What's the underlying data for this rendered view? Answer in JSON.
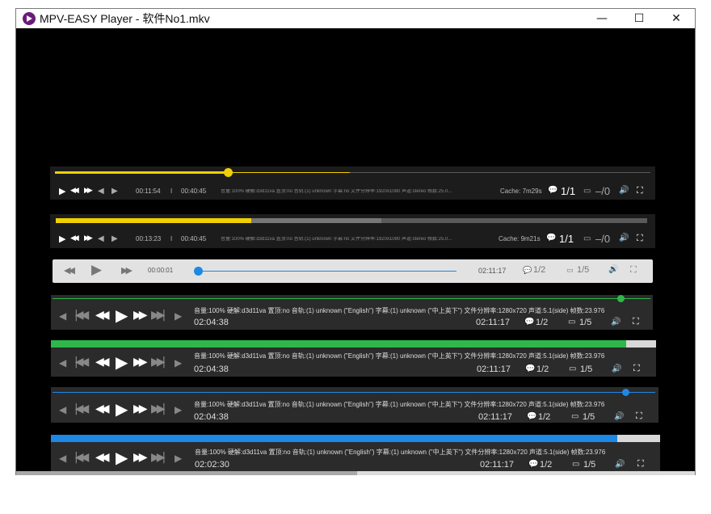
{
  "window": {
    "title": "MPV-EASY Player - 软件No1.mkv",
    "min": "—",
    "max": "☐",
    "close": "✕"
  },
  "icons": {
    "play": "▶",
    "rewind": "◀◀",
    "forward": "▶▶",
    "prev": "◀",
    "next": "▶",
    "skip_back": "|◀◀",
    "skip_fwd": "▶▶|",
    "comment": "💬",
    "sub": "▭",
    "volume": "🔊",
    "screen": "⛶"
  },
  "bar1": {
    "time": "00:11:54",
    "sep": "I",
    "duration": "00:40:45",
    "info": "音量:100% 硬解:d3d11va 置顶:no 音轨:(1) unknown 字幕:no 文件分辨率:1920x1080 声道:stereo 帧数:25.0...",
    "cache": "Cache: 7m29s",
    "chapters": "1/1",
    "subs": "–/0",
    "progress": 0.29,
    "buffer": 0.495,
    "color": "#f0d000"
  },
  "bar2": {
    "time": "00:13:23",
    "sep": "I",
    "duration": "00:40:45",
    "info": "音量:100% 硬解:d3d11va 置顶:no 音轨:(1) unknown 字幕:no 文件分辨率:1920x1080 声道:stereo 帧数:25.0...",
    "cache": "Cache: 9m21s",
    "chapters": "1/1",
    "subs": "–/0",
    "progress": 0.33,
    "buffer": 0.55,
    "color": "#f0d000"
  },
  "bar3": {
    "time": "00:00:01",
    "duration": "02:11:17",
    "chapters": "1/2",
    "subs": "1/5",
    "progress": 0.0,
    "color": "#1e88e5"
  },
  "bar4": {
    "info": "音量:100% 硬解:d3d11va 置顶:no 音轨:(1) unknown (\"English\") 字幕:(1) unknown (\"中上英下\") 文件分辨率:1280x720 声道:5.1(side) 帧数:23.976",
    "time": "02:04:38",
    "duration": "02:11:17",
    "chapters": "1/2",
    "subs": "1/5",
    "progress": 0.95,
    "color": "#2eb84a"
  },
  "bar5": {
    "info": "音量:100% 硬解:d3d11va 置顶:no 音轨:(1) unknown (\"English\") 字幕:(1) unknown (\"中上英下\") 文件分辨率:1280x720 声道:5.1(side) 帧数:23.976",
    "time": "02:04:38",
    "duration": "02:11:17",
    "chapters": "1/2",
    "subs": "1/5",
    "progress": 0.95,
    "color": "#2eb84a"
  },
  "bar6": {
    "info": "音量:100% 硬解:d3d11va 置顶:no 音轨:(1) unknown (\"English\") 字幕:(1) unknown (\"中上英下\") 文件分辨率:1280x720 声道:5.1(side) 帧数:23.976",
    "time": "02:04:38",
    "duration": "02:11:17",
    "chapters": "1/2",
    "subs": "1/5",
    "progress": 0.95,
    "color": "#1e88e5"
  },
  "bar7": {
    "info": "音量:100% 硬解:d3d11va 置顶:no 音轨:(1) unknown (\"English\") 字幕:(1) unknown (\"中上英下\") 文件分辨率:1280x720 声道:5.1(side) 帧数:23.976",
    "time": "02:02:30",
    "duration": "02:11:17",
    "chapters": "1/2",
    "subs": "1/5",
    "progress": 0.93,
    "color": "#1e88e5"
  }
}
